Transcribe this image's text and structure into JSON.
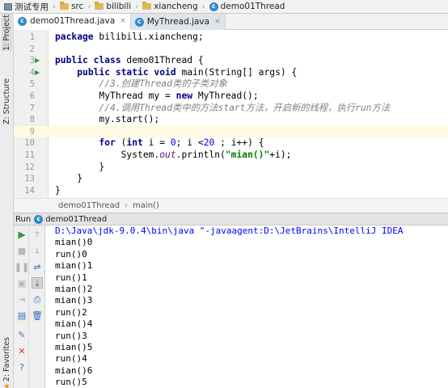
{
  "breadcrumb": [
    "测试专用",
    "src",
    "bilibili",
    "xiancheng",
    "demo01Thread"
  ],
  "tool_windows": {
    "project": "1: Project",
    "structure": "Z: Structure",
    "favorites": "2: Favorites"
  },
  "tabs": [
    {
      "label": "demo01Thread.java",
      "close": "×"
    },
    {
      "label": "MyThread.java",
      "close": "×"
    }
  ],
  "editor": {
    "line_numbers": [
      "1",
      "2",
      "3",
      "4",
      "5",
      "6",
      "7",
      "8",
      "9",
      "10",
      "11",
      "12",
      "13",
      "14"
    ],
    "highlighted_line": 9
  },
  "code_text": {
    "l1_kw": "package",
    "l1_rest": " bilibili.xiancheng;",
    "l3_kw": "public class",
    "l3_rest": " demo01Thread {",
    "l4_kw": "public static void",
    "l4_rest": " main(String[] args) {",
    "l5": "//3.创建Thread类的子类对象",
    "l6_a": "MyThread my = ",
    "l6_kw": "new",
    "l6_b": " MyThread();",
    "l7": "//4.调用Thread类中的方法start方法，开启新的线程，执行run方法",
    "l8": "my.start();",
    "l10_kw1": "for",
    "l10_a": " (",
    "l10_kw2": "int",
    "l10_b": " i = ",
    "l10_n1": "0",
    "l10_c": "; i <",
    "l10_n2": "20",
    "l10_d": " ; i++) {",
    "l11_a": "System.",
    "l11_fld": "out",
    "l11_b": ".println(",
    "l11_str": "\"mian()\"",
    "l11_c": "+i);",
    "l12": "}",
    "l13": "}",
    "l14": "}"
  },
  "editor_crumb": {
    "class": "demo01Thread",
    "method": "main()"
  },
  "run_panel": {
    "label": "Run",
    "config": "demo01Thread"
  },
  "console": {
    "command": "D:\\Java\\jdk-9.0.4\\bin\\java \"-javaagent:D:\\JetBrains\\IntelliJ IDEA",
    "lines": [
      "mian()0",
      "run()0",
      "mian()1",
      "run()1",
      "mian()2",
      "mian()3",
      "run()2",
      "mian()4",
      "run()3",
      "mian()5",
      "run()4",
      "mian()6",
      "run()5"
    ]
  },
  "colors": {
    "keyword": "#000080",
    "comment": "#808080",
    "string": "#008000",
    "number": "#0000ff",
    "field": "#660e7a",
    "current_line": "#fffae3"
  }
}
